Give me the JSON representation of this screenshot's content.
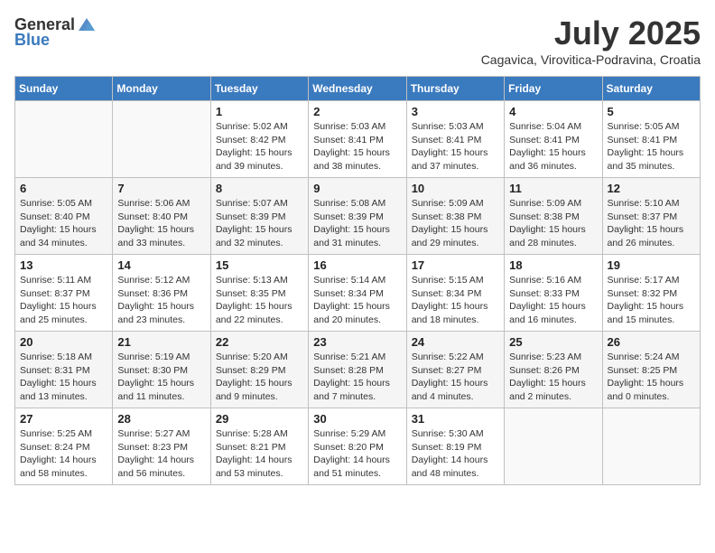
{
  "header": {
    "logo_general": "General",
    "logo_blue": "Blue",
    "month": "July 2025",
    "location": "Cagavica, Virovitica-Podravina, Croatia"
  },
  "days_of_week": [
    "Sunday",
    "Monday",
    "Tuesday",
    "Wednesday",
    "Thursday",
    "Friday",
    "Saturday"
  ],
  "weeks": [
    [
      {
        "day": "",
        "info": ""
      },
      {
        "day": "",
        "info": ""
      },
      {
        "day": "1",
        "sunrise": "Sunrise: 5:02 AM",
        "sunset": "Sunset: 8:42 PM",
        "daylight": "Daylight: 15 hours and 39 minutes."
      },
      {
        "day": "2",
        "sunrise": "Sunrise: 5:03 AM",
        "sunset": "Sunset: 8:41 PM",
        "daylight": "Daylight: 15 hours and 38 minutes."
      },
      {
        "day": "3",
        "sunrise": "Sunrise: 5:03 AM",
        "sunset": "Sunset: 8:41 PM",
        "daylight": "Daylight: 15 hours and 37 minutes."
      },
      {
        "day": "4",
        "sunrise": "Sunrise: 5:04 AM",
        "sunset": "Sunset: 8:41 PM",
        "daylight": "Daylight: 15 hours and 36 minutes."
      },
      {
        "day": "5",
        "sunrise": "Sunrise: 5:05 AM",
        "sunset": "Sunset: 8:41 PM",
        "daylight": "Daylight: 15 hours and 35 minutes."
      }
    ],
    [
      {
        "day": "6",
        "sunrise": "Sunrise: 5:05 AM",
        "sunset": "Sunset: 8:40 PM",
        "daylight": "Daylight: 15 hours and 34 minutes."
      },
      {
        "day": "7",
        "sunrise": "Sunrise: 5:06 AM",
        "sunset": "Sunset: 8:40 PM",
        "daylight": "Daylight: 15 hours and 33 minutes."
      },
      {
        "day": "8",
        "sunrise": "Sunrise: 5:07 AM",
        "sunset": "Sunset: 8:39 PM",
        "daylight": "Daylight: 15 hours and 32 minutes."
      },
      {
        "day": "9",
        "sunrise": "Sunrise: 5:08 AM",
        "sunset": "Sunset: 8:39 PM",
        "daylight": "Daylight: 15 hours and 31 minutes."
      },
      {
        "day": "10",
        "sunrise": "Sunrise: 5:09 AM",
        "sunset": "Sunset: 8:38 PM",
        "daylight": "Daylight: 15 hours and 29 minutes."
      },
      {
        "day": "11",
        "sunrise": "Sunrise: 5:09 AM",
        "sunset": "Sunset: 8:38 PM",
        "daylight": "Daylight: 15 hours and 28 minutes."
      },
      {
        "day": "12",
        "sunrise": "Sunrise: 5:10 AM",
        "sunset": "Sunset: 8:37 PM",
        "daylight": "Daylight: 15 hours and 26 minutes."
      }
    ],
    [
      {
        "day": "13",
        "sunrise": "Sunrise: 5:11 AM",
        "sunset": "Sunset: 8:37 PM",
        "daylight": "Daylight: 15 hours and 25 minutes."
      },
      {
        "day": "14",
        "sunrise": "Sunrise: 5:12 AM",
        "sunset": "Sunset: 8:36 PM",
        "daylight": "Daylight: 15 hours and 23 minutes."
      },
      {
        "day": "15",
        "sunrise": "Sunrise: 5:13 AM",
        "sunset": "Sunset: 8:35 PM",
        "daylight": "Daylight: 15 hours and 22 minutes."
      },
      {
        "day": "16",
        "sunrise": "Sunrise: 5:14 AM",
        "sunset": "Sunset: 8:34 PM",
        "daylight": "Daylight: 15 hours and 20 minutes."
      },
      {
        "day": "17",
        "sunrise": "Sunrise: 5:15 AM",
        "sunset": "Sunset: 8:34 PM",
        "daylight": "Daylight: 15 hours and 18 minutes."
      },
      {
        "day": "18",
        "sunrise": "Sunrise: 5:16 AM",
        "sunset": "Sunset: 8:33 PM",
        "daylight": "Daylight: 15 hours and 16 minutes."
      },
      {
        "day": "19",
        "sunrise": "Sunrise: 5:17 AM",
        "sunset": "Sunset: 8:32 PM",
        "daylight": "Daylight: 15 hours and 15 minutes."
      }
    ],
    [
      {
        "day": "20",
        "sunrise": "Sunrise: 5:18 AM",
        "sunset": "Sunset: 8:31 PM",
        "daylight": "Daylight: 15 hours and 13 minutes."
      },
      {
        "day": "21",
        "sunrise": "Sunrise: 5:19 AM",
        "sunset": "Sunset: 8:30 PM",
        "daylight": "Daylight: 15 hours and 11 minutes."
      },
      {
        "day": "22",
        "sunrise": "Sunrise: 5:20 AM",
        "sunset": "Sunset: 8:29 PM",
        "daylight": "Daylight: 15 hours and 9 minutes."
      },
      {
        "day": "23",
        "sunrise": "Sunrise: 5:21 AM",
        "sunset": "Sunset: 8:28 PM",
        "daylight": "Daylight: 15 hours and 7 minutes."
      },
      {
        "day": "24",
        "sunrise": "Sunrise: 5:22 AM",
        "sunset": "Sunset: 8:27 PM",
        "daylight": "Daylight: 15 hours and 4 minutes."
      },
      {
        "day": "25",
        "sunrise": "Sunrise: 5:23 AM",
        "sunset": "Sunset: 8:26 PM",
        "daylight": "Daylight: 15 hours and 2 minutes."
      },
      {
        "day": "26",
        "sunrise": "Sunrise: 5:24 AM",
        "sunset": "Sunset: 8:25 PM",
        "daylight": "Daylight: 15 hours and 0 minutes."
      }
    ],
    [
      {
        "day": "27",
        "sunrise": "Sunrise: 5:25 AM",
        "sunset": "Sunset: 8:24 PM",
        "daylight": "Daylight: 14 hours and 58 minutes."
      },
      {
        "day": "28",
        "sunrise": "Sunrise: 5:27 AM",
        "sunset": "Sunset: 8:23 PM",
        "daylight": "Daylight: 14 hours and 56 minutes."
      },
      {
        "day": "29",
        "sunrise": "Sunrise: 5:28 AM",
        "sunset": "Sunset: 8:21 PM",
        "daylight": "Daylight: 14 hours and 53 minutes."
      },
      {
        "day": "30",
        "sunrise": "Sunrise: 5:29 AM",
        "sunset": "Sunset: 8:20 PM",
        "daylight": "Daylight: 14 hours and 51 minutes."
      },
      {
        "day": "31",
        "sunrise": "Sunrise: 5:30 AM",
        "sunset": "Sunset: 8:19 PM",
        "daylight": "Daylight: 14 hours and 48 minutes."
      },
      {
        "day": "",
        "info": ""
      },
      {
        "day": "",
        "info": ""
      }
    ]
  ]
}
